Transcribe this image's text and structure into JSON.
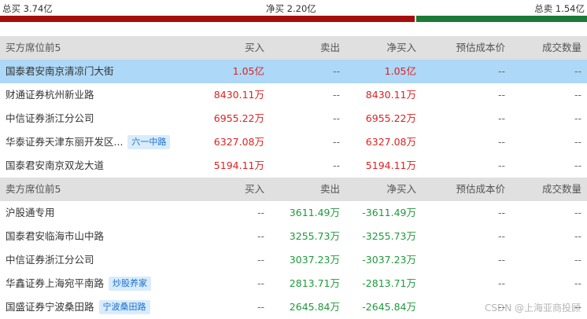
{
  "summary": {
    "total_buy": "总买 3.74亿",
    "net_buy": "净买 2.20亿",
    "total_sell": "总卖 1.54亿",
    "colors": {
      "buy": "#a50d0d",
      "sell": "#1a7a36"
    }
  },
  "buy_section": {
    "header": {
      "name": "买方席位前5",
      "buy": "买入",
      "sell": "卖出",
      "net": "净买入",
      "cost": "预估成本价",
      "volume": "成交数量"
    },
    "rows": [
      {
        "name": "国泰君安南京清凉门大街",
        "tag": "",
        "buy": "1.05亿",
        "sell": "--",
        "net": "1.05亿",
        "cost": "--",
        "volume": "--"
      },
      {
        "name": "财通证券杭州新业路",
        "tag": "",
        "buy": "8430.11万",
        "sell": "--",
        "net": "8430.11万",
        "cost": "--",
        "volume": "--"
      },
      {
        "name": "中信证券浙江分公司",
        "tag": "",
        "buy": "6955.22万",
        "sell": "--",
        "net": "6955.22万",
        "cost": "--",
        "volume": "--"
      },
      {
        "name": "华泰证券天津东丽开发区...",
        "tag": "六一中路",
        "buy": "6327.08万",
        "sell": "--",
        "net": "6327.08万",
        "cost": "--",
        "volume": "--"
      },
      {
        "name": "国泰君安南京双龙大道",
        "tag": "",
        "buy": "5194.11万",
        "sell": "--",
        "net": "5194.11万",
        "cost": "--",
        "volume": "--"
      }
    ]
  },
  "sell_section": {
    "header": {
      "name": "卖方席位前5",
      "buy": "买入",
      "sell": "卖出",
      "net": "净买入",
      "cost": "预估成本价",
      "volume": "成交数量"
    },
    "rows": [
      {
        "name": "沪股通专用",
        "tag": "",
        "buy": "--",
        "sell": "3611.49万",
        "net": "-3611.49万",
        "cost": "--",
        "volume": "--"
      },
      {
        "name": "国泰君安临海市山中路",
        "tag": "",
        "buy": "--",
        "sell": "3255.73万",
        "net": "-3255.73万",
        "cost": "--",
        "volume": "--"
      },
      {
        "name": "中信证券浙江分公司",
        "tag": "",
        "buy": "--",
        "sell": "3037.23万",
        "net": "-3037.23万",
        "cost": "--",
        "volume": "--"
      },
      {
        "name": "华鑫证券上海宛平南路",
        "tag": "炒股养家",
        "buy": "--",
        "sell": "2813.71万",
        "net": "-2813.71万",
        "cost": "--",
        "volume": "--"
      },
      {
        "name": "国盛证券宁波桑田路",
        "tag": "宁波桑田路",
        "buy": "--",
        "sell": "2645.84万",
        "net": "-2645.84万",
        "cost": "--",
        "volume": "--"
      }
    ]
  },
  "watermark": "CSDN @上海亚商投顾"
}
